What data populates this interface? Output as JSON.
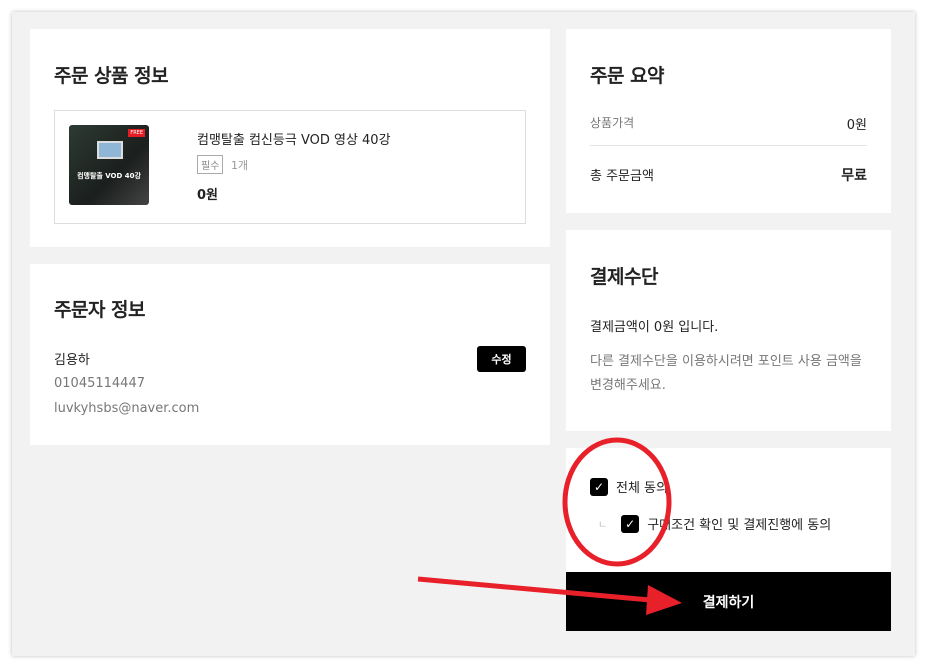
{
  "order_items": {
    "title": "주문 상품 정보",
    "product": {
      "name": "컴맹탈출 컴신등극 VOD 영상 40강",
      "badge": "필수",
      "quantity": "1개",
      "price": "0원",
      "thumbnail_title": "컴맹탈출 VOD 40강",
      "thumbnail_tag": "FREE"
    }
  },
  "orderer": {
    "title": "주문자 정보",
    "name": "김용하",
    "phone": "01045114447",
    "email": "luvkyhsbs@naver.com",
    "edit_label": "수정"
  },
  "summary": {
    "title": "주문 요약",
    "product_price_label": "상품가격",
    "product_price": "0원",
    "total_label": "총 주문금액",
    "total": "무료"
  },
  "payment": {
    "title": "결제수단",
    "amount_text": "결제금액이 0원 입니다.",
    "note": "다른 결제수단을 이용하시려면 포인트 사용 금액을 변경해주세요."
  },
  "agreement": {
    "all_label": "전체 동의",
    "all_checked": true,
    "terms_label": "구매조건 확인 및 결제진행에 동의",
    "terms_checked": true,
    "sub_marker": "ㄴ"
  },
  "pay_button": "결제하기",
  "colors": {
    "accent": "#000000",
    "annotation": "#e8202a"
  }
}
